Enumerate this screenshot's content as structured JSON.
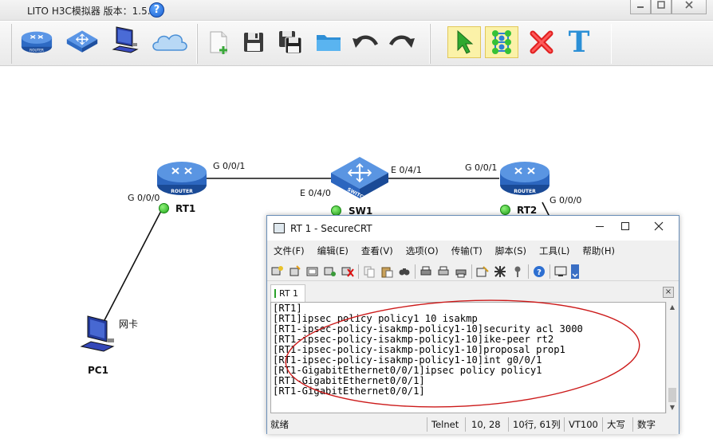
{
  "app": {
    "title": "LITO H3C模拟器 版本：1.5.2",
    "help_glyph": "?",
    "window_controls": [
      "minimize",
      "maximize",
      "close"
    ]
  },
  "toolbar": {
    "devices": [
      {
        "name": "router-icon",
        "label": "ROUTER"
      },
      {
        "name": "switch-icon",
        "label": "SWITCH"
      },
      {
        "name": "pc-icon",
        "label": ""
      },
      {
        "name": "cloud-icon",
        "label": ""
      }
    ],
    "file_tools": [
      "new-file-icon",
      "save-icon",
      "save-as-icon",
      "open-folder-icon",
      "undo-icon",
      "redo-icon"
    ],
    "edit_tools": [
      "select-pointer-icon",
      "connect-icon",
      "delete-icon",
      "text-icon"
    ],
    "text_tool_glyph": "T"
  },
  "topology": {
    "devices": [
      {
        "id": "RT1",
        "label": "RT1",
        "type": "router",
        "router_text": "ROUTER"
      },
      {
        "id": "SW1",
        "label": "SW1",
        "type": "switch",
        "switch_text": "SWITCH"
      },
      {
        "id": "RT2",
        "label": "RT2",
        "type": "router",
        "router_text": "ROUTER"
      },
      {
        "id": "PC1",
        "label": "PC1",
        "type": "pc"
      }
    ],
    "ports": {
      "rt1_g001": "G 0/0/1",
      "rt1_g000": "G 0/0/0",
      "sw1_e040": "E 0/4/0",
      "sw1_e041": "E 0/4/1",
      "rt2_g001": "G 0/0/1",
      "rt2_g000": "G 0/0/0",
      "pc1_nic": "网卡"
    },
    "link_color": "#111111",
    "status_color": "#22a81c"
  },
  "securecrt": {
    "title": "RT 1 - SecureCRT",
    "menus": [
      "文件(F)",
      "编辑(E)",
      "查看(V)",
      "选项(O)",
      "传输(T)",
      "脚本(S)",
      "工具(L)",
      "帮助(H)"
    ],
    "tab_label": "RT 1",
    "tab_close": "×",
    "terminal_lines": [
      "[RT1]",
      "[RT1]ipsec policy policy1 10 isakmp",
      "[RT1-ipsec-policy-isakmp-policy1-10]security acl 3000",
      "[RT1-ipsec-policy-isakmp-policy1-10]ike-peer rt2",
      "[RT1-ipsec-policy-isakmp-policy1-10]proposal prop1",
      "[RT1-ipsec-policy-isakmp-policy1-10]int g0/0/1",
      "[RT1-GigabitEthernet0/0/1]ipsec policy policy1",
      "[RT1-GigabitEthernet0/0/1]",
      "[RT1-GigabitEthernet0/0/1]"
    ],
    "status": {
      "ready": "就绪",
      "protocol": "Telnet",
      "cursor": "10,  28",
      "rows_cols": "10行, 61列",
      "terminal": "VT100",
      "caps": "大写",
      "num": "数字"
    }
  },
  "annotation": {
    "ellipse_color": "#cc1a1a"
  }
}
